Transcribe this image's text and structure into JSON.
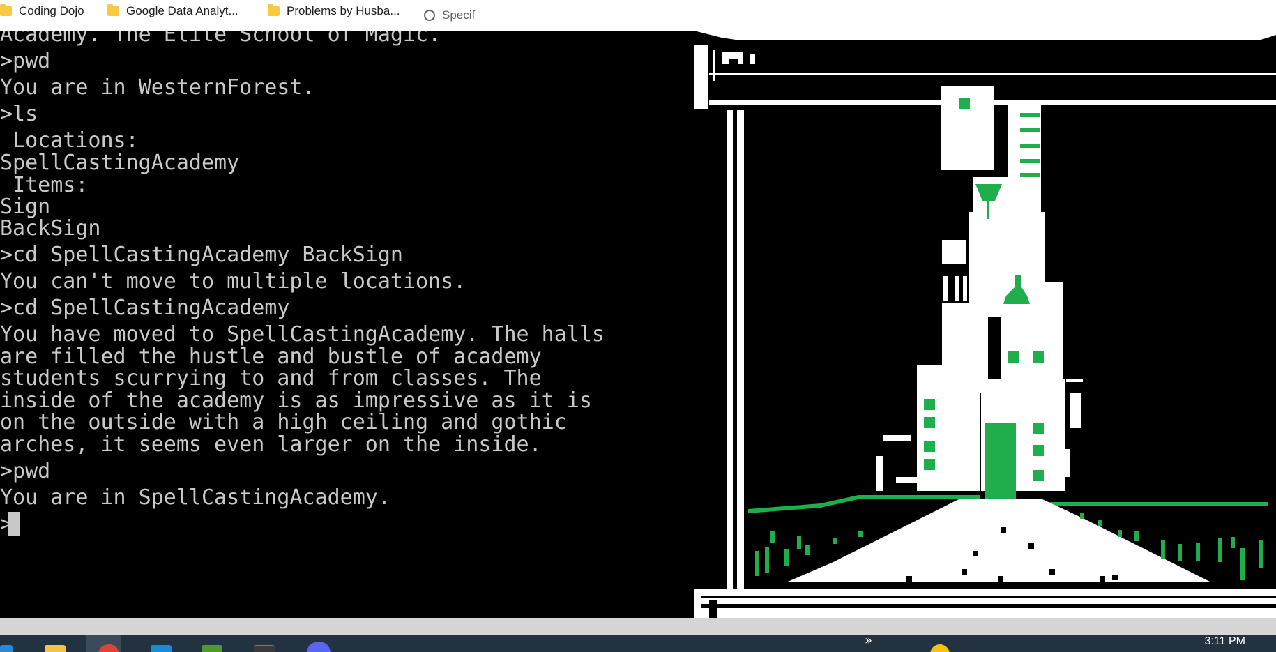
{
  "bookmarks": [
    {
      "label": "Coding Dojo",
      "icon": "folder-icon"
    },
    {
      "label": "Google Data Analyt...",
      "icon": "folder-icon"
    },
    {
      "label": "Problems by Husba...",
      "icon": "folder-icon"
    },
    {
      "label": "Specif",
      "icon": "globe-icon"
    }
  ],
  "terminal": {
    "lines": [
      "Academy. The Elite School of Magic.",
      ">pwd",
      "You are in WesternForest.",
      ">ls",
      " Locations:",
      "SpellCastingAcademy",
      " Items:",
      "Sign",
      "BackSign",
      ">cd SpellCastingAcademy BackSign",
      "You can't move to multiple locations.",
      ">cd SpellCastingAcademy",
      "You have moved to SpellCastingAcademy. The halls",
      "are filled the hustle and bustle of academy",
      "students scurrying to and from classes. The",
      "inside of the academy is as impressive as it is",
      "on the outside with a high ceiling and gothic",
      "arches, it seems even larger on the inside.",
      ">pwd",
      "You are in SpellCastingAcademy.",
      ">"
    ],
    "text_color": "#c8c8c8",
    "background": "#000000"
  },
  "art": {
    "colors": {
      "green": "#1fae4b",
      "white": "#ffffff",
      "black": "#000000"
    }
  },
  "taskbar": {
    "time": "3:11 PM",
    "background": "#233241",
    "icons": [
      "start-icon",
      "file-explorer-icon",
      "chrome-icon",
      "vscode-icon",
      "app-icon",
      "terminal-icon",
      "discord-icon"
    ]
  }
}
